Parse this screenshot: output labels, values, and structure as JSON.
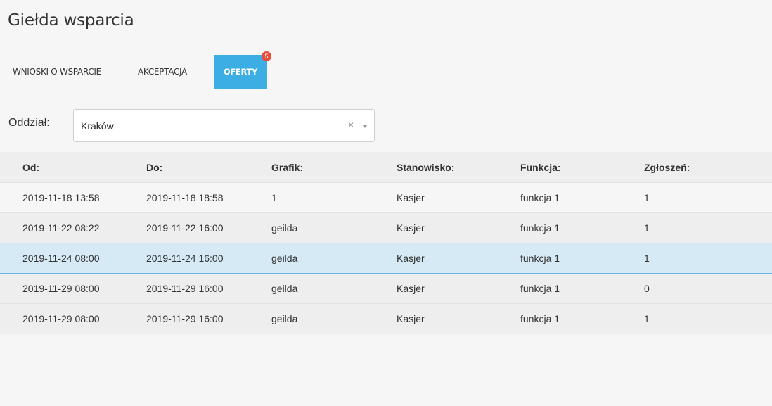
{
  "page": {
    "title": "Giełda wsparcia"
  },
  "tabs": [
    {
      "label": "WNIOSKI O WSPARCIE",
      "active": false
    },
    {
      "label": "AKCEPTACJA",
      "active": false
    },
    {
      "label": "OFERTY",
      "active": true,
      "badge": "5"
    }
  ],
  "filter": {
    "label": "Oddział:",
    "value": "Kraków",
    "clear_icon": "×",
    "arrow_icon": "chevron-down-icon"
  },
  "table": {
    "columns": [
      "Od:",
      "Do:",
      "Grafik:",
      "Stanowisko:",
      "Funkcja:",
      "Zgłoszeń:"
    ],
    "rows": [
      [
        "2019-11-18 13:58",
        "2019-11-18 18:58",
        "1",
        "Kasjer",
        "funkcja 1",
        "1"
      ],
      [
        "2019-11-22 08:22",
        "2019-11-22 16:00",
        "geilda",
        "Kasjer",
        "funkcja 1",
        "1"
      ],
      [
        "2019-11-24 08:00",
        "2019-11-24 16:00",
        "geilda",
        "Kasjer",
        "funkcja 1",
        "1"
      ],
      [
        "2019-11-29 08:00",
        "2019-11-29 16:00",
        "geilda",
        "Kasjer",
        "funkcja 1",
        "0"
      ],
      [
        "2019-11-29 08:00",
        "2019-11-29 16:00",
        "geilda",
        "Kasjer",
        "funkcja 1",
        "1"
      ]
    ],
    "selected_row": 2
  },
  "colors": {
    "accent": "#3daee3",
    "badge": "#e74c3c",
    "selected_row": "#d6eaf6"
  }
}
